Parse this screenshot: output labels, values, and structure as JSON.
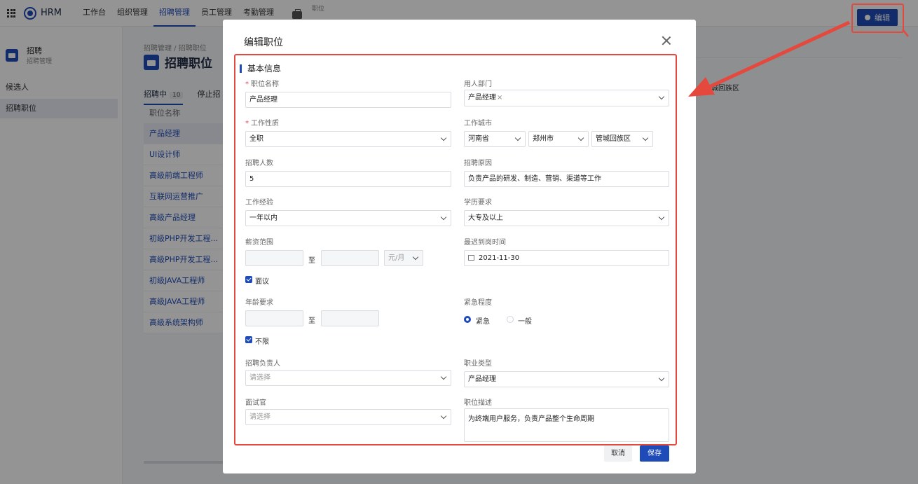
{
  "topbar": {
    "brand": "HRM",
    "nav": [
      "工作台",
      "组织管理",
      "招聘管理",
      "员工管理",
      "考勤管理"
    ],
    "active_nav": 2,
    "crumb": "职位",
    "edit_label": "编辑"
  },
  "sidebar": {
    "title": "招聘",
    "subtitle": "招聘管理",
    "items": [
      {
        "label": "候选人"
      },
      {
        "label": "招聘职位",
        "active": true
      }
    ]
  },
  "main": {
    "breadcrumb": "招聘管理 / 招聘职位",
    "title": "招聘职位",
    "tabs": [
      {
        "label": "招聘中",
        "count": "10"
      },
      {
        "label": "停止招"
      }
    ],
    "column_header": "职位名称",
    "jobs": [
      "产品经理",
      "UI设计师",
      "高级前端工程师",
      "互联网运营推广",
      "高级产品经理",
      "初级PHP开发工程...",
      "高级PHP开发工程...",
      "初级JAVA工程师",
      "高级JAVA工程师",
      "高级系统架构师"
    ],
    "side_text": "城回族区"
  },
  "modal": {
    "title": "编辑职位",
    "section": "基本信息",
    "position_name": {
      "label": "职位名称",
      "value": "产品经理"
    },
    "department": {
      "label": "用人部门",
      "tag": "产品经理",
      "remove": "×"
    },
    "job_nature": {
      "label": "工作性质",
      "value": "全职"
    },
    "city": {
      "label": "工作城市",
      "province": "河南省",
      "city": "郑州市",
      "district": "管城回族区"
    },
    "headcount": {
      "label": "招聘人数",
      "value": "5"
    },
    "reason": {
      "label": "招聘原因",
      "value": "负责产品的研发、制造、营销、渠道等工作"
    },
    "experience": {
      "label": "工作经验",
      "value": "一年以内"
    },
    "education": {
      "label": "学历要求",
      "value": "大专及以上"
    },
    "salary": {
      "label": "薪资范围",
      "to": "至",
      "unit": "元/月",
      "negotiable": "面议"
    },
    "arrival": {
      "label": "最迟到岗时间",
      "value": "2021-11-30"
    },
    "age": {
      "label": "年龄要求",
      "to": "至",
      "unlimited": "不限"
    },
    "urgency": {
      "label": "紧急程度",
      "options": [
        "紧急",
        "一般"
      ],
      "selected": 0
    },
    "recruiter": {
      "label": "招聘负责人",
      "placeholder": "请选择"
    },
    "job_type": {
      "label": "职业类型",
      "value": "产品经理"
    },
    "interviewer": {
      "label": "面试官",
      "placeholder": "请选择"
    },
    "description": {
      "label": "职位描述",
      "value": "为终端用户服务，负责产品整个生命周期"
    },
    "cancel_label": "取消",
    "save_label": "保存"
  },
  "colors": {
    "accent": "#1e4bb8",
    "annotation": "#e5483d"
  }
}
